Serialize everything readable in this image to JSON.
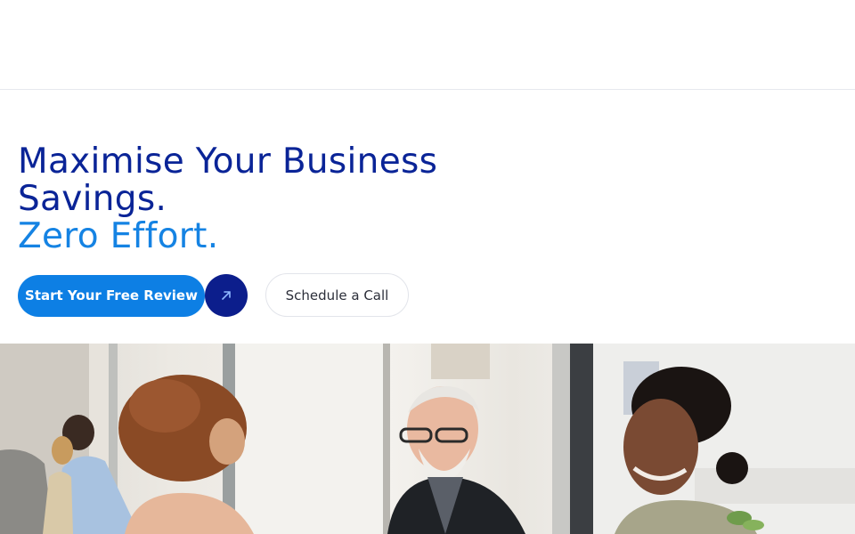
{
  "hero": {
    "headline_line1": "Maximise Your Business",
    "headline_line2": "Savings.",
    "headline_accent": "Zero Effort.",
    "primary_cta": "Start Your Free Review",
    "secondary_cta": "Schedule a Call"
  },
  "icons": {
    "arrow": "arrow-up-right-icon"
  },
  "colors": {
    "headline_dark": "#0a2497",
    "headline_accent": "#1583e3",
    "primary_button": "#0d7fe4",
    "arrow_button": "#0c1e8c"
  }
}
